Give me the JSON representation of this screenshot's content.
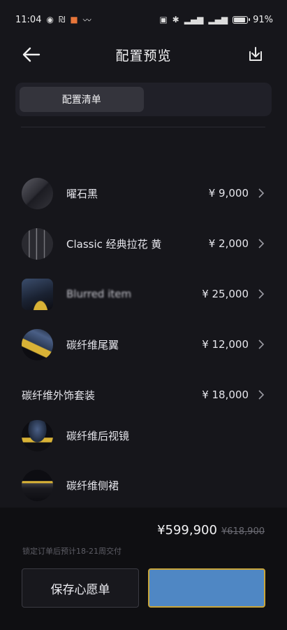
{
  "status_bar": {
    "time": "11:04",
    "battery": "91%",
    "icons": [
      "eye-icon",
      "nfc-icon",
      "app-badge-icon",
      "signal-wave-icon",
      "vibrate-icon",
      "bluetooth-icon",
      "5g-signal-icon",
      "5g-signal-icon",
      "battery-icon"
    ]
  },
  "header": {
    "title": "配置预览",
    "back_icon": "arrow-left-icon",
    "download_icon": "download-icon"
  },
  "tabs": [
    {
      "label": "配置清单",
      "active": true
    },
    {
      "label": "",
      "active": false
    }
  ],
  "items": [
    {
      "label": "曜石黑",
      "price": "¥ 9,000",
      "thumb": "paint-swatch"
    },
    {
      "label": "Classic 经典拉花 黄",
      "price": "¥ 2,000",
      "thumb": "stripe-swatch"
    },
    {
      "label": "Blurred item",
      "price": "¥ 25,000",
      "thumb": "car-part"
    },
    {
      "label": "碳纤维尾翼",
      "price": "¥ 12,000",
      "thumb": "car-part"
    }
  ],
  "group": {
    "label": "碳纤维外饰套装",
    "price": "¥ 18,000",
    "children": [
      {
        "label": "碳纤维后视镜",
        "thumb": "car-part"
      },
      {
        "label": "碳纤维侧裙",
        "thumb": "car-part"
      }
    ]
  },
  "footer": {
    "price_now": "¥599,900",
    "price_was": "¥618,900",
    "delivery_note": "锁定订单后预计18-21周交付",
    "wishlist_button": "保存心愿单",
    "primary_button": ""
  },
  "colors": {
    "background": "#16161b",
    "accent_yellow": "#d8b236",
    "primary_button": "#4f87c4"
  }
}
